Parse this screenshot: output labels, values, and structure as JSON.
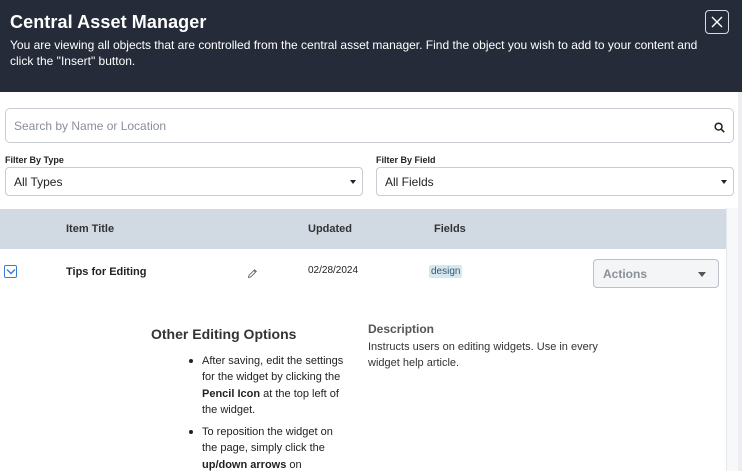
{
  "modal": {
    "title": "Central Asset Manager",
    "description": "You are viewing all objects that are controlled from the central asset manager. Find the object you wish to add to your content and click the \"Insert\" button."
  },
  "search": {
    "placeholder": "Search by Name or Location",
    "value": ""
  },
  "filters": {
    "type": {
      "label": "Filter By Type",
      "selected": "All Types"
    },
    "field": {
      "label": "Filter By Field",
      "selected": "All Fields"
    }
  },
  "table": {
    "columns": [
      "Item Title",
      "Updated",
      "Fields"
    ],
    "rows": [
      {
        "title": "Tips for Editing",
        "updated": "02/28/2024",
        "tag": "design",
        "actions_label": "Actions",
        "checked": true
      }
    ]
  },
  "detail": {
    "heading": "Other Editing Options",
    "bullets": [
      {
        "before": "After saving, edit the settings for the widget by clicking the ",
        "bold": "Pencil Icon",
        "after": " at the top left of the widget."
      },
      {
        "before": "To reposition the widget on the page, simply click the ",
        "bold": "up/down arrows",
        "after": " on"
      }
    ],
    "description_heading": "Description",
    "description_text": "Instructs users on editing widgets. Use in every widget help article."
  },
  "icons": [
    "close-icon",
    "search-icon",
    "caret-down-icon",
    "check-icon",
    "pencil-icon"
  ],
  "colors": {
    "header_bg": "#252b38",
    "table_head_bg": "#d1d9e2",
    "tag_bg": "#d5e8ef",
    "checkbox": "#3a7bd5"
  }
}
